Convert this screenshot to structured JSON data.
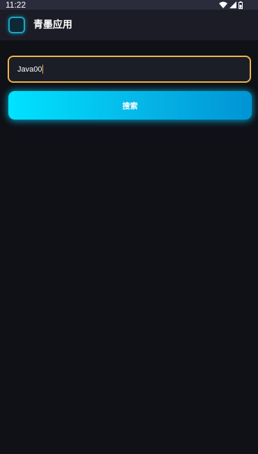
{
  "status_bar": {
    "time": "11:22",
    "icons": [
      "wifi-icon",
      "signal-icon",
      "battery-icon"
    ]
  },
  "app_bar": {
    "title": "青墨应用",
    "logo_icon": "app-logo-icon"
  },
  "search": {
    "value": "Java00",
    "button_label": "搜索"
  },
  "colors": {
    "background": "#101117",
    "input_border": "#f0b64a",
    "button_gradient_start": "#00e3ff",
    "button_gradient_end": "#0094d4"
  }
}
